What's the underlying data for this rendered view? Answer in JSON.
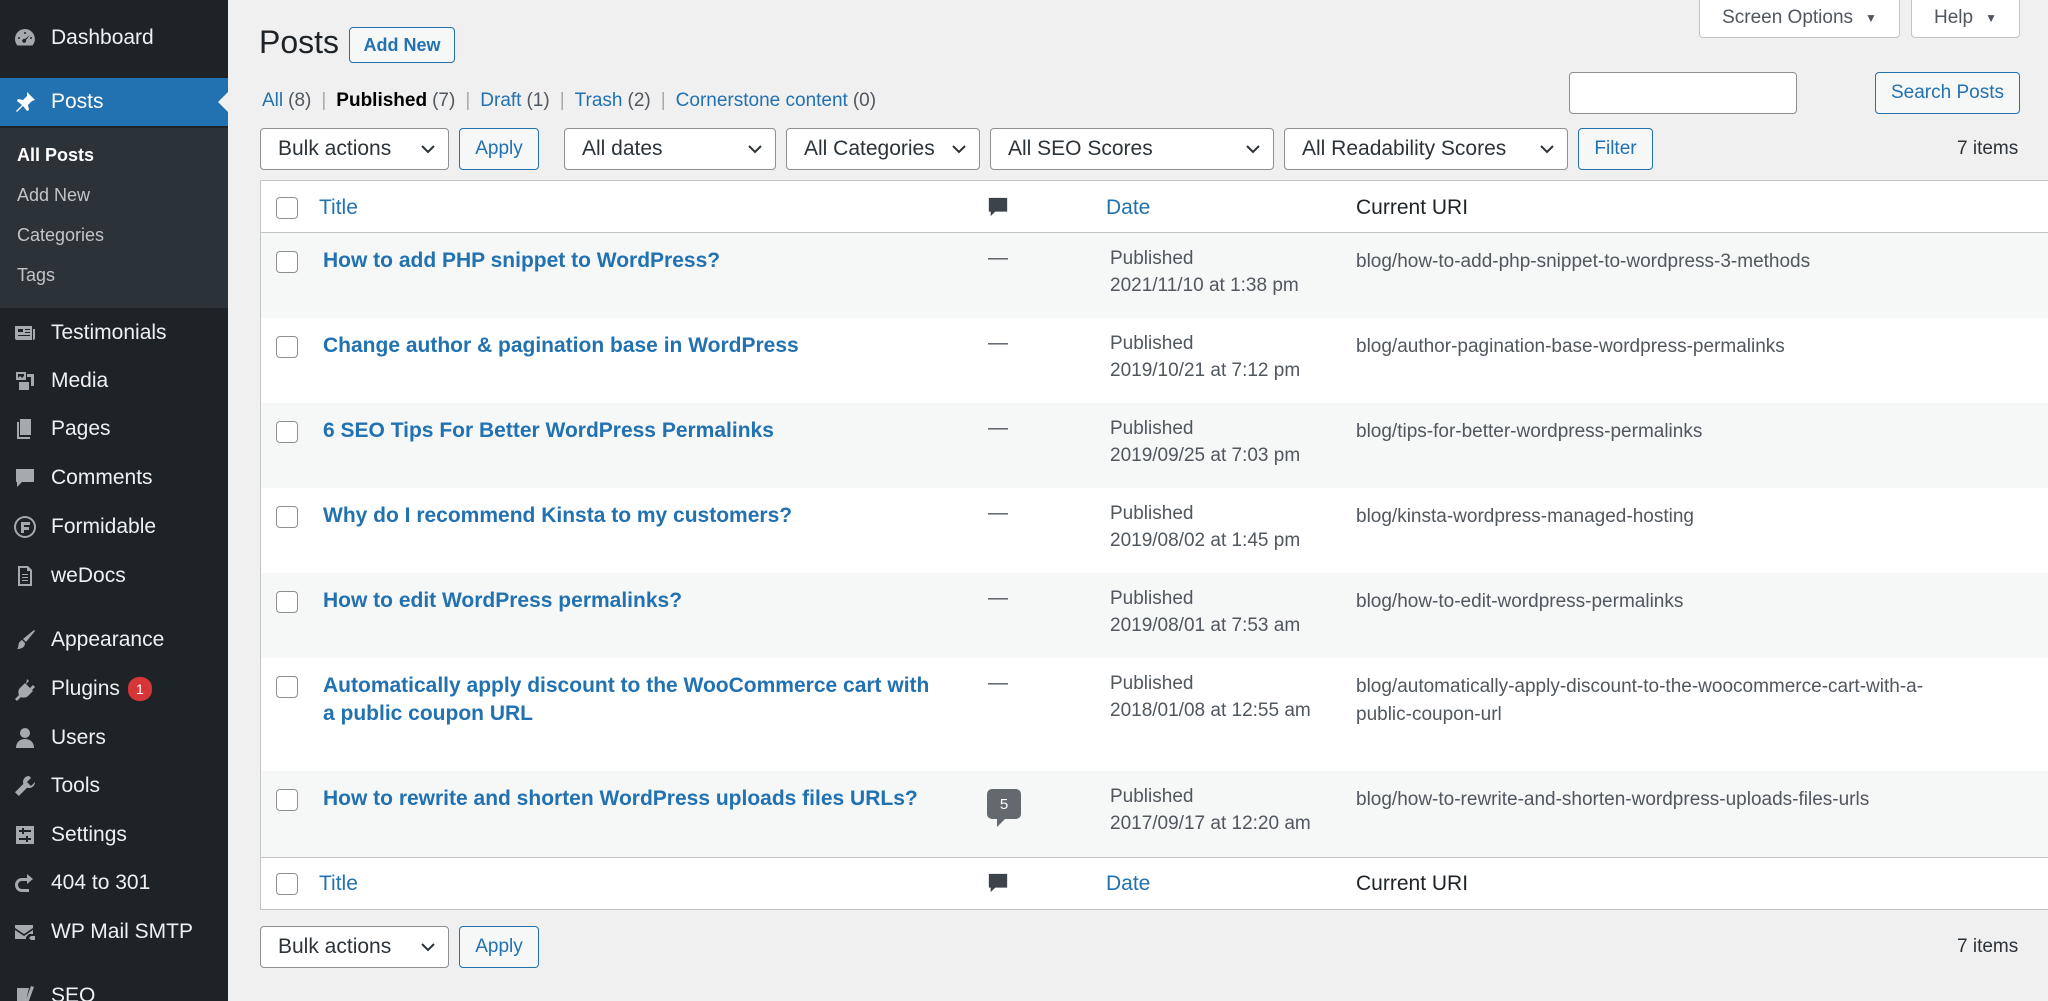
{
  "sidebar": {
    "dashboard": "Dashboard",
    "posts": "Posts",
    "submenu": [
      "All Posts",
      "Add New",
      "Categories",
      "Tags"
    ],
    "testimonials": "Testimonials",
    "media": "Media",
    "pages": "Pages",
    "comments": "Comments",
    "formidable": "Formidable",
    "wedocs": "weDocs",
    "appearance": "Appearance",
    "plugins": "Plugins",
    "plugins_badge": "1",
    "users": "Users",
    "tools": "Tools",
    "settings": "Settings",
    "redirect": "404 to 301",
    "wpmail": "WP Mail SMTP",
    "seo": "SEO"
  },
  "header": {
    "title": "Posts",
    "add_new": "Add New",
    "screen_options": "Screen Options",
    "help": "Help"
  },
  "filters": {
    "views": [
      {
        "label": "All",
        "count": "(8)"
      },
      {
        "label": "Published",
        "count": "(7)"
      },
      {
        "label": "Draft",
        "count": "(1)"
      },
      {
        "label": "Trash",
        "count": "(2)"
      },
      {
        "label": "Cornerstone content",
        "count": "(0)"
      }
    ],
    "search_button": "Search Posts",
    "bulk_actions": "Bulk actions",
    "apply": "Apply",
    "all_dates": "All dates",
    "all_categories": "All Categories",
    "all_seo": "All SEO Scores",
    "all_readability": "All Readability Scores",
    "filter": "Filter",
    "items_count": "7 items"
  },
  "table": {
    "columns": {
      "title": "Title",
      "date": "Date",
      "uri": "Current URI"
    },
    "rows": [
      {
        "title": "How to add PHP snippet to WordPress?",
        "comments": "—",
        "status": "Published",
        "date": "2021/11/10 at 1:38 pm",
        "uri": "blog/how-to-add-php-snippet-to-wordpress-3-methods"
      },
      {
        "title": "Change author & pagination base in WordPress",
        "comments": "—",
        "status": "Published",
        "date": "2019/10/21 at 7:12 pm",
        "uri": "blog/author-pagination-base-wordpress-permalinks"
      },
      {
        "title": "6 SEO Tips For Better WordPress Permalinks",
        "comments": "—",
        "status": "Published",
        "date": "2019/09/25 at 7:03 pm",
        "uri": "blog/tips-for-better-wordpress-permalinks"
      },
      {
        "title": "Why do I recommend Kinsta to my customers?",
        "comments": "—",
        "status": "Published",
        "date": "2019/08/02 at 1:45 pm",
        "uri": "blog/kinsta-wordpress-managed-hosting"
      },
      {
        "title": "How to edit WordPress permalinks?",
        "comments": "—",
        "status": "Published",
        "date": "2019/08/01 at 7:53 am",
        "uri": "blog/how-to-edit-wordpress-permalinks"
      },
      {
        "title": "Automatically apply discount to the WooCommerce cart with a public coupon URL",
        "comments": "—",
        "status": "Published",
        "date": "2018/01/08 at 12:55 am",
        "uri": "blog/automatically-apply-discount-to-the-woocommerce-cart-with-a-public-coupon-url"
      },
      {
        "title": "How to rewrite and shorten WordPress uploads files URLs?",
        "comments": "5",
        "status": "Published",
        "date": "2017/09/17 at 12:20 am",
        "uri": "blog/how-to-rewrite-and-shorten-wordpress-uploads-files-urls"
      }
    ]
  },
  "footer": {
    "bulk_actions": "Bulk actions",
    "apply": "Apply",
    "items_count": "7 items"
  }
}
